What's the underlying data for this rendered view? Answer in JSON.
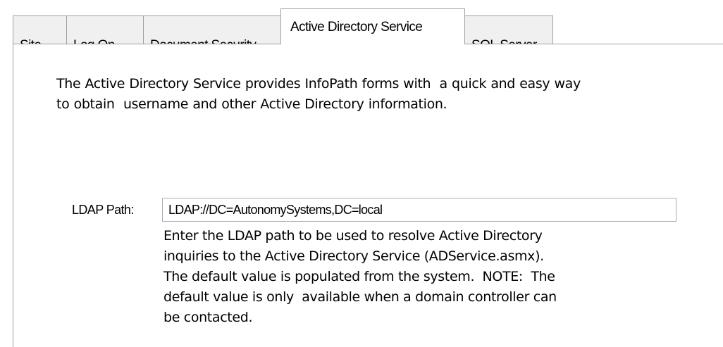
{
  "tabs": [
    {
      "label": "Site",
      "active": false
    },
    {
      "label": "Log On",
      "active": false
    },
    {
      "label": "Document Security",
      "active": false
    },
    {
      "label": "Active Directory Service",
      "active": true
    },
    {
      "label": "SQL Server",
      "active": false
    }
  ],
  "page": {
    "intro": "The Active Directory Service provides InfoPath forms with  a quick and easy way\nto obtain  username and other Active Directory information.",
    "ldap_label": "LDAP Path:",
    "ldap_value": "LDAP://DC=AutonomySystems,DC=local",
    "help": "Enter the LDAP path to be used to resolve Active Directory\ninquiries to the Active Directory Service (ADService.asmx).\nThe default value is populated from the system.  NOTE:  The\ndefault value is only  available when a domain controller can\nbe contacted."
  }
}
